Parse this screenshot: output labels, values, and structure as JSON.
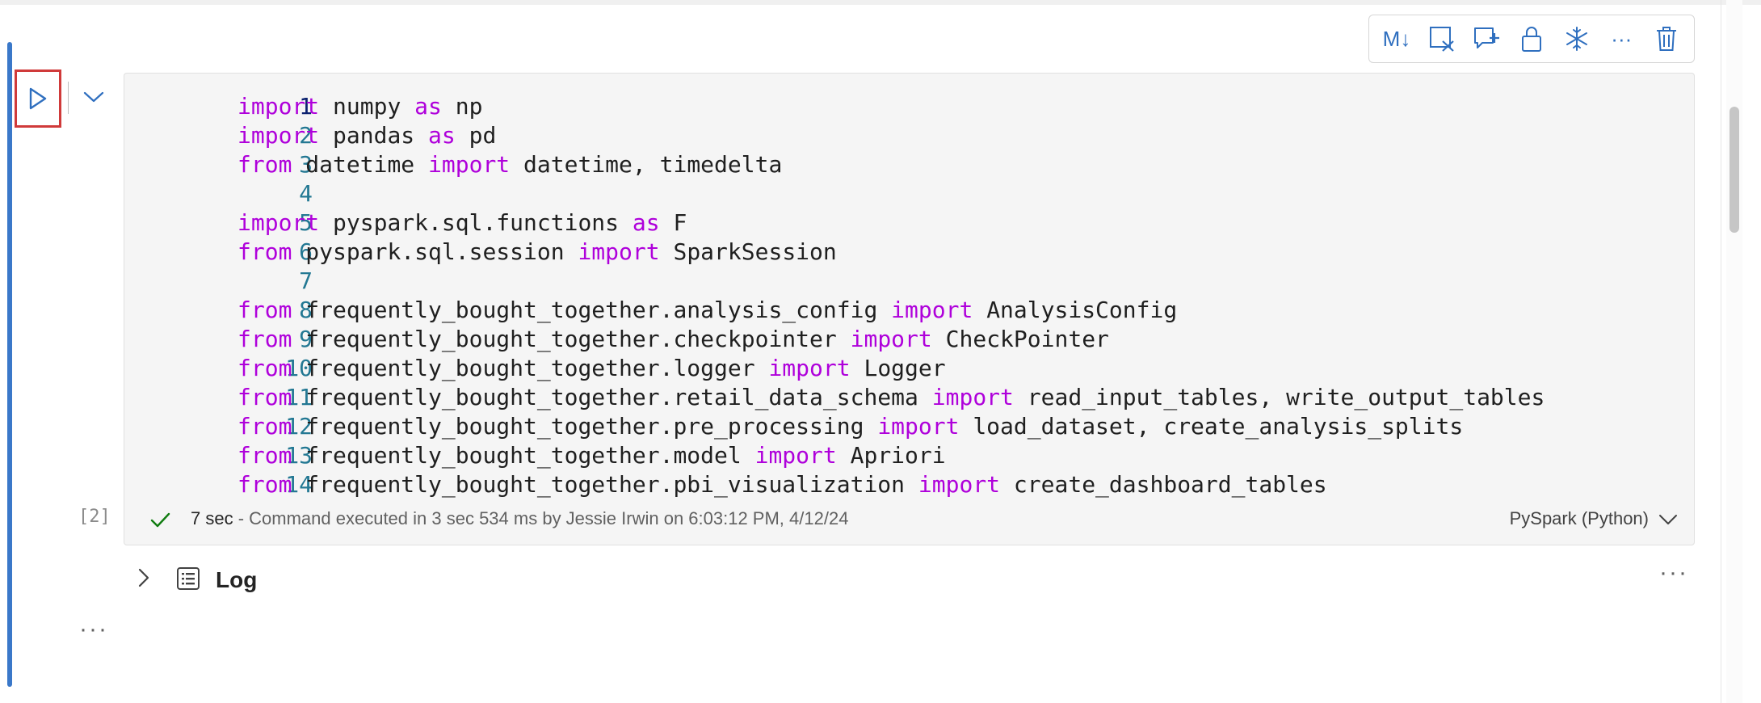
{
  "toolbar": {
    "icons": [
      "markdown-toggle-icon",
      "clear-output-icon",
      "add-comment-icon",
      "lock-icon",
      "freeze-icon",
      "more-icon",
      "delete-icon"
    ],
    "markdown_label": "M↓",
    "more_label": "···"
  },
  "cell": {
    "code_lines": [
      {
        "n": "1",
        "text": "import numpy as np"
      },
      {
        "n": "2",
        "text": "import pandas as pd"
      },
      {
        "n": "3",
        "text": "from datetime import datetime, timedelta"
      },
      {
        "n": "4",
        "text": ""
      },
      {
        "n": "5",
        "text": "import pyspark.sql.functions as F"
      },
      {
        "n": "6",
        "text": "from pyspark.sql.session import SparkSession"
      },
      {
        "n": "7",
        "text": ""
      },
      {
        "n": "8",
        "text": "from frequently_bought_together.analysis_config import AnalysisConfig"
      },
      {
        "n": "9",
        "text": "from frequently_bought_together.checkpointer import CheckPointer"
      },
      {
        "n": "10",
        "text": "from frequently_bought_together.logger import Logger"
      },
      {
        "n": "11",
        "text": "from frequently_bought_together.retail_data_schema import read_input_tables, write_output_tables"
      },
      {
        "n": "12",
        "text": "from frequently_bought_together.pre_processing import load_dataset, create_analysis_splits"
      },
      {
        "n": "13",
        "text": "from frequently_bought_together.model import Apriori"
      },
      {
        "n": "14",
        "text": "from frequently_bought_together.pbi_visualization import create_dashboard_tables"
      }
    ],
    "execution_count": "[2]",
    "status_duration": "7 sec",
    "status_detail": " - Command executed in 3 sec 534 ms by Jessie Irwin on 6:03:12 PM, 4/12/24",
    "language": "PySpark (Python)"
  },
  "log": {
    "label": "Log",
    "more": "···"
  },
  "output_more": "···",
  "colors": {
    "accent": "#3a78c9",
    "keyword": "#af00db",
    "line_number": "#237893",
    "highlight_box": "#d03a3a",
    "success": "#107c10"
  }
}
